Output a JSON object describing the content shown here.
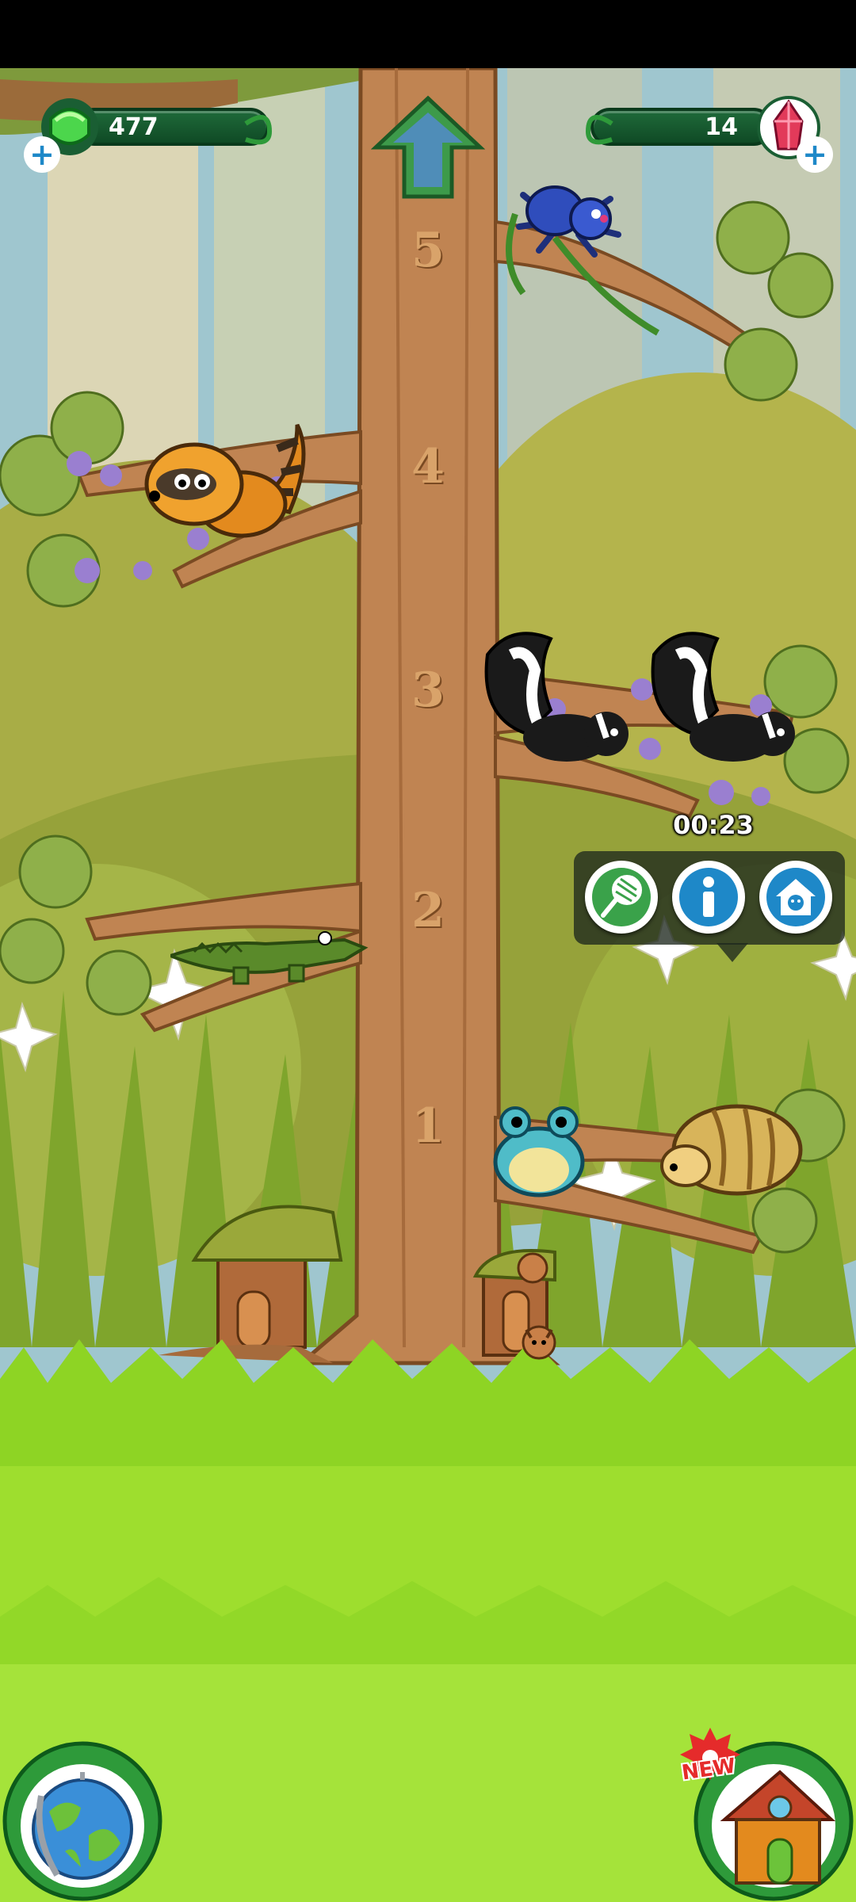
{
  "hud": {
    "gems_green": {
      "value": "477",
      "icon": "green-gem-icon",
      "add_icon": "plus-icon"
    },
    "gems_red": {
      "value": "14",
      "icon": "red-crystal-icon",
      "add_icon": "plus-icon"
    },
    "up_button": {
      "icon": "up-arrow-icon"
    }
  },
  "tree": {
    "floors": [
      "5",
      "4",
      "3",
      "2",
      "1"
    ]
  },
  "animals": [
    {
      "name": "tarantula",
      "floor": "5"
    },
    {
      "name": "raccoon",
      "floor": "4"
    },
    {
      "name": "skunk",
      "floor": "3"
    },
    {
      "name": "skunk",
      "floor": "3"
    },
    {
      "name": "crocodile",
      "floor": "2"
    },
    {
      "name": "frog",
      "floor": "1"
    },
    {
      "name": "hedgehog",
      "floor": "1"
    }
  ],
  "selection_popup": {
    "timer": "00:23",
    "buttons": [
      {
        "icon": "net-icon"
      },
      {
        "icon": "info-icon"
      },
      {
        "icon": "house-icon"
      }
    ]
  },
  "bottom": {
    "globe_button": {
      "icon": "globe-icon"
    },
    "shop_button": {
      "icon": "house-icon",
      "badge": "NEW"
    }
  },
  "colors": {
    "hud_bar": "#1a5e33",
    "grass": "#9ede2e",
    "trunk": "#c08452",
    "info_blue": "#1e88c8"
  }
}
